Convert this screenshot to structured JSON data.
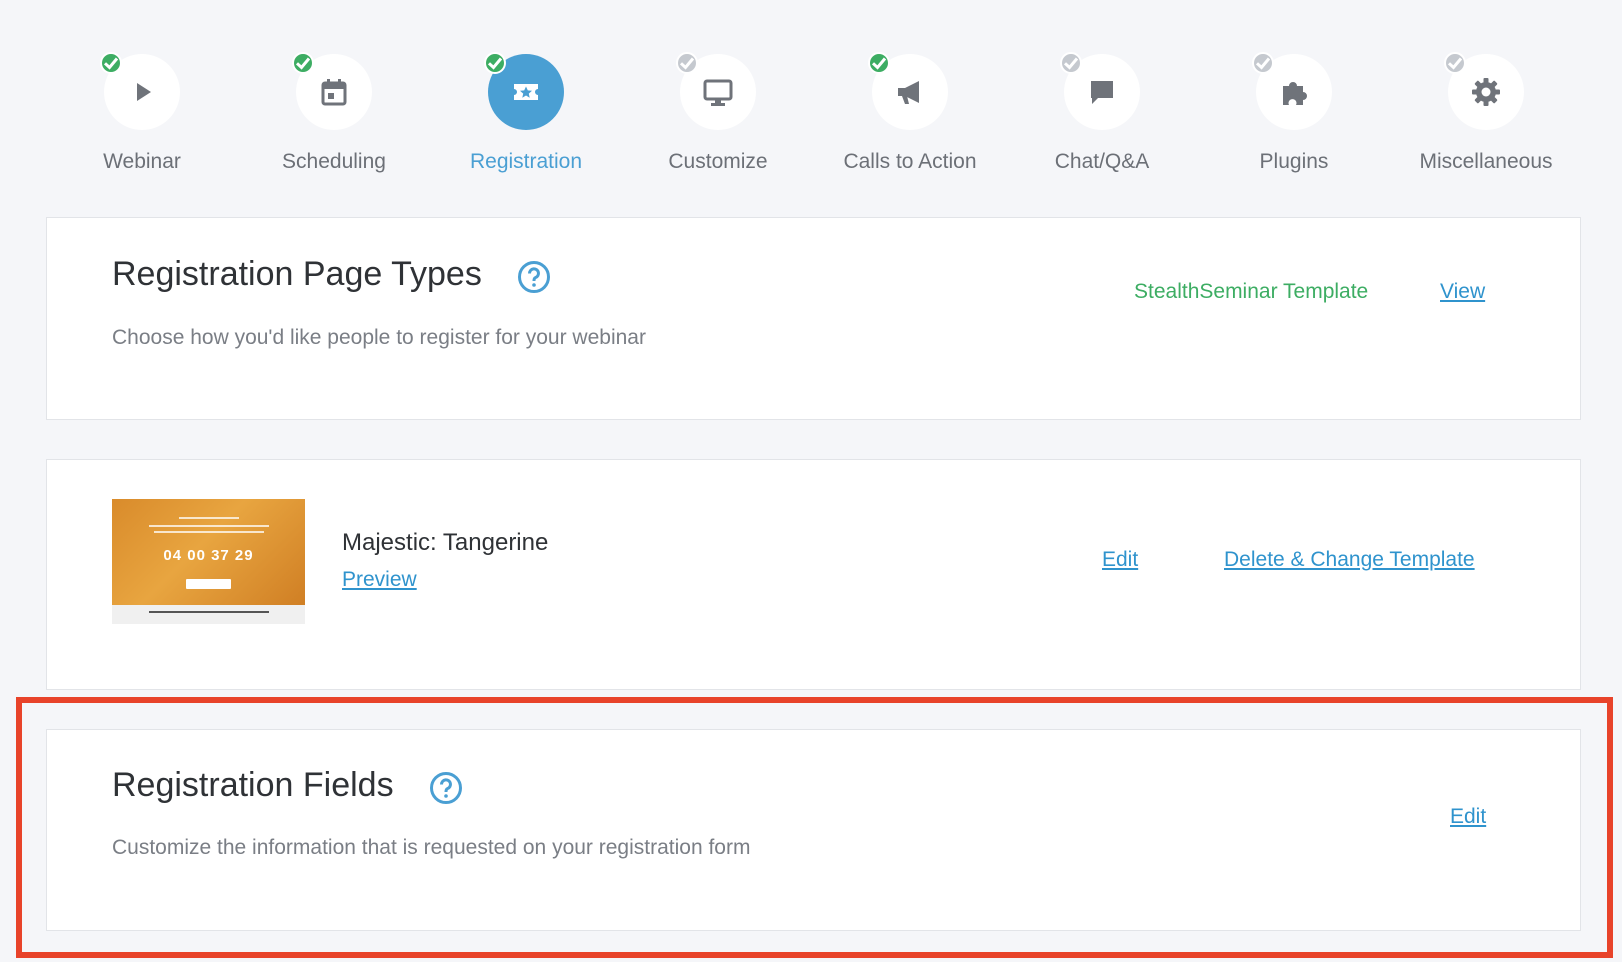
{
  "steps": [
    {
      "label": "Webinar",
      "status": "done",
      "icon": "play-icon"
    },
    {
      "label": "Scheduling",
      "status": "done",
      "icon": "calendar-icon"
    },
    {
      "label": "Registration",
      "status": "done",
      "icon": "ticket-star-icon",
      "active": true
    },
    {
      "label": "Customize",
      "status": "todo",
      "icon": "monitor-icon"
    },
    {
      "label": "Calls to Action",
      "status": "done",
      "icon": "megaphone-icon"
    },
    {
      "label": "Chat/Q&A",
      "status": "todo",
      "icon": "chat-icon"
    },
    {
      "label": "Plugins",
      "status": "todo",
      "icon": "puzzle-icon"
    },
    {
      "label": "Miscellaneous",
      "status": "todo",
      "icon": "gear-icon"
    }
  ],
  "page_types": {
    "title": "Registration Page Types",
    "description": "Choose how you'd like people to register for your webinar",
    "template_source": "StealthSeminar Template",
    "view_label": "View"
  },
  "template": {
    "name": "Majestic: Tangerine",
    "preview_label": "Preview",
    "edit_label": "Edit",
    "delete_label": "Delete & Change Template",
    "thumbnail_countdown": "04 00 37 29"
  },
  "fields": {
    "title": "Registration Fields",
    "description": "Customize the information that is requested on your registration form",
    "edit_label": "Edit"
  },
  "colors": {
    "accent": "#4a9fd3",
    "link": "#2f93cd",
    "done": "#3dad63",
    "highlight": "#e8432a"
  }
}
